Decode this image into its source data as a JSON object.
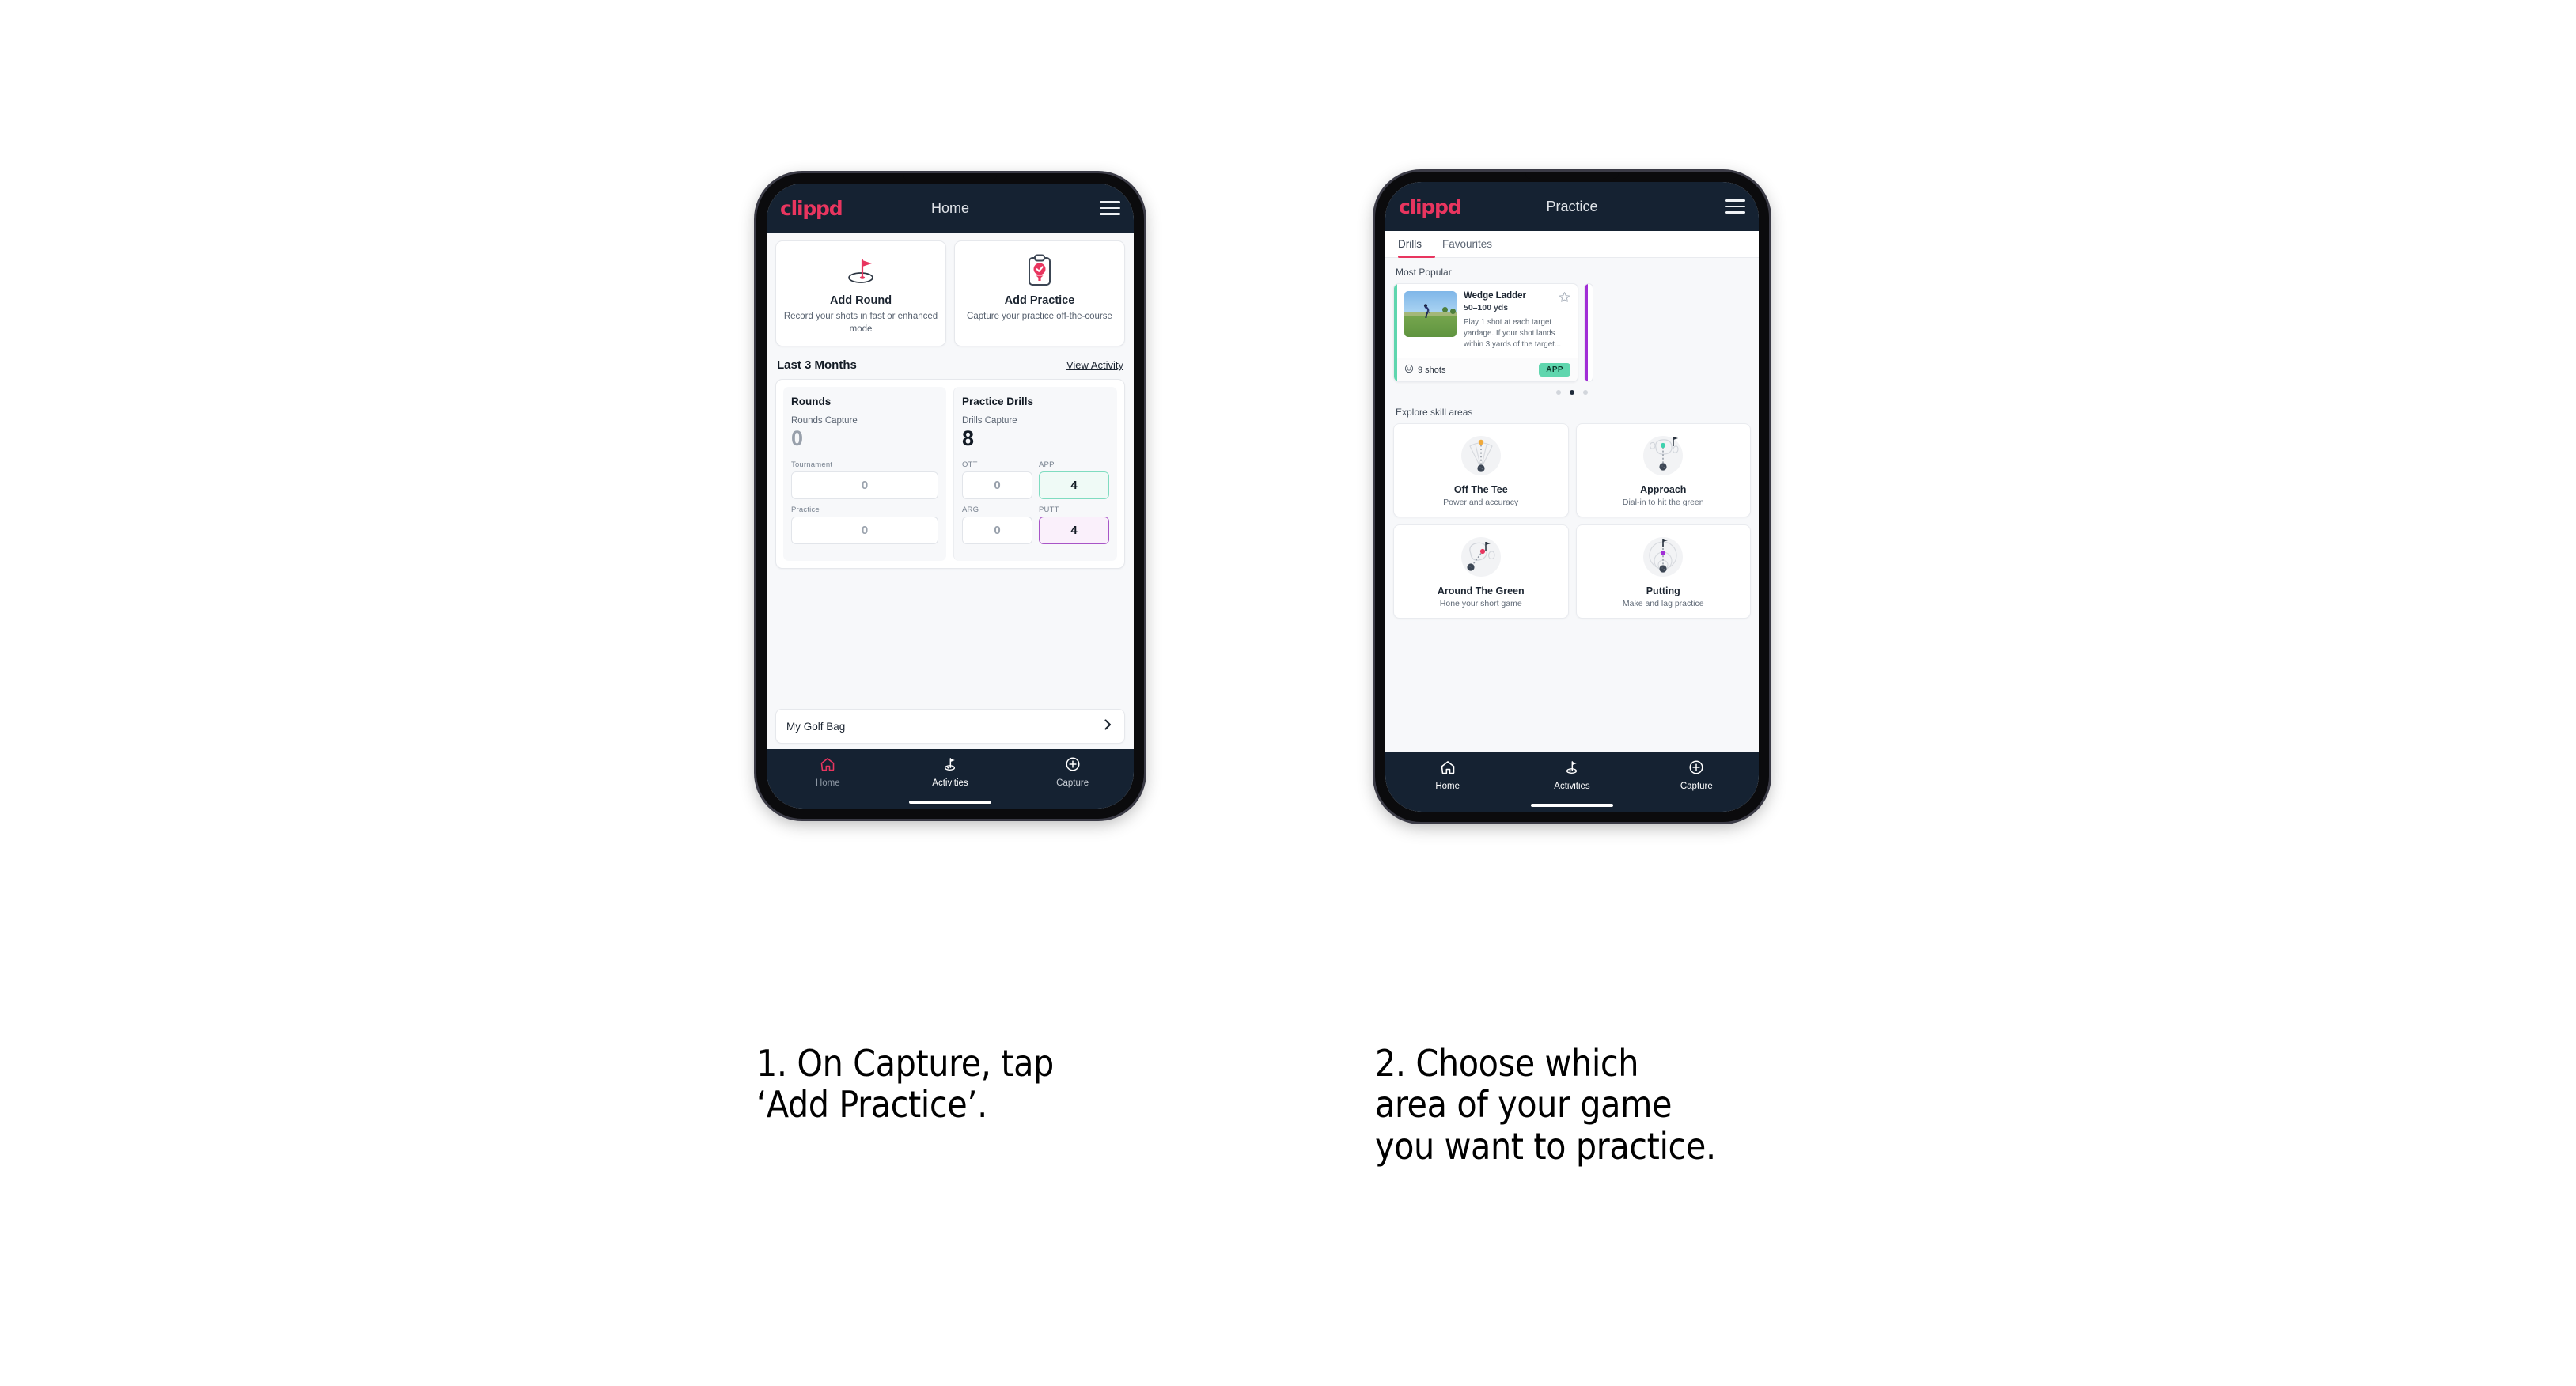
{
  "page": {
    "background": "#ffffff"
  },
  "brand": {
    "name": "clippd",
    "accent": "#e8355f",
    "dark": "#152232"
  },
  "phone1": {
    "appbar": {
      "logo": "clippd",
      "title": "Home",
      "menu_icon": "hamburger-icon"
    },
    "actions": [
      {
        "icon": "golf-flag-hole-icon",
        "title": "Add Round",
        "subtitle": "Record your shots in fast or enhanced mode"
      },
      {
        "icon": "clipboard-check-tee-icon",
        "title": "Add Practice",
        "subtitle": "Capture your practice off-the-course"
      }
    ],
    "section": {
      "title": "Last 3 Months",
      "link": "View Activity"
    },
    "rounds": {
      "heading": "Rounds",
      "capture_label": "Rounds Capture",
      "capture_value": "0",
      "fields": [
        {
          "label": "Tournament",
          "value": "0",
          "state": "empty"
        },
        {
          "label": "Practice",
          "value": "0",
          "state": "empty"
        }
      ]
    },
    "drills": {
      "heading": "Practice Drills",
      "capture_label": "Drills Capture",
      "capture_value": "8",
      "fields": [
        {
          "label": "OTT",
          "value": "0",
          "state": "empty"
        },
        {
          "label": "APP",
          "value": "4",
          "state": "green"
        },
        {
          "label": "ARG",
          "value": "0",
          "state": "empty"
        },
        {
          "label": "PUTT",
          "value": "4",
          "state": "purple"
        }
      ]
    },
    "golf_bag": {
      "label": "My Golf Bag",
      "chevron": "chevron-right-icon"
    },
    "bottom_nav": [
      {
        "icon": "home-icon",
        "label": "Home",
        "state": "active"
      },
      {
        "icon": "golf-flag-icon",
        "label": "Activities",
        "state": "selected"
      },
      {
        "icon": "plus-circle-icon",
        "label": "Capture",
        "state": "normal"
      }
    ]
  },
  "phone2": {
    "appbar": {
      "logo": "clippd",
      "title": "Practice",
      "menu_icon": "hamburger-icon"
    },
    "tabs": [
      {
        "label": "Drills",
        "active": true
      },
      {
        "label": "Favourites",
        "active": false
      }
    ],
    "most_popular": {
      "heading": "Most Popular"
    },
    "drill_card": {
      "accent_color": "#5fd6ae",
      "name": "Wedge Ladder",
      "yardage": "50–100 yds",
      "description": "Play 1 shot at each target yardage. If your shot lands within 3 yards of the target...",
      "shots": "9 shots",
      "shots_icon": "clock-icon",
      "chip": "APP",
      "favourite_icon": "star-outline-icon",
      "thumbnail": "golfer-chipping-photo"
    },
    "peek_card": {
      "accent_color": "#a12ed6"
    },
    "carousel_dots": {
      "count": 3,
      "active_index": 1
    },
    "skills": {
      "heading": "Explore skill areas",
      "items": [
        {
          "art": "off-the-tee-icon",
          "title": "Off The Tee",
          "subtitle": "Power and accuracy",
          "dot_color": "#f0a93b"
        },
        {
          "art": "approach-icon",
          "title": "Approach",
          "subtitle": "Dial-in to hit the green",
          "dot_color": "#3ed2ae"
        },
        {
          "art": "around-the-green-icon",
          "title": "Around The Green",
          "subtitle": "Hone your short game",
          "dot_color": "#e8355f"
        },
        {
          "art": "putting-icon",
          "title": "Putting",
          "subtitle": "Make and lag practice",
          "dot_color": "#a12ed6"
        }
      ]
    },
    "bottom_nav": [
      {
        "icon": "home-icon",
        "label": "Home",
        "state": "normal"
      },
      {
        "icon": "golf-flag-icon",
        "label": "Activities",
        "state": "selected"
      },
      {
        "icon": "plus-circle-icon",
        "label": "Capture",
        "state": "normal"
      }
    ]
  },
  "captions": [
    {
      "text": "1. On Capture, tap\n‘Add Practice’."
    },
    {
      "text": "2. Choose which\narea of your game\nyou want to practice."
    }
  ]
}
